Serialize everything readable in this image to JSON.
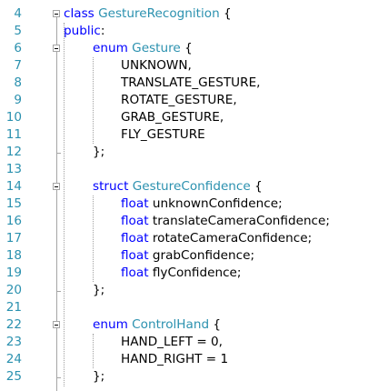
{
  "lines": [
    {
      "num": "4",
      "tokens": [
        {
          "t": "class",
          "c": "kw"
        },
        {
          "t": " ",
          "c": "pl"
        },
        {
          "t": "GestureRecognition",
          "c": "ty"
        },
        {
          "t": " {",
          "c": "pl"
        }
      ]
    },
    {
      "num": "5",
      "tokens": [
        {
          "t": "public",
          "c": "kw"
        },
        {
          "t": ":",
          "c": "pl"
        }
      ]
    },
    {
      "num": "6",
      "tokens": [
        {
          "t": "enum",
          "c": "kw"
        },
        {
          "t": " ",
          "c": "pl"
        },
        {
          "t": "Gesture",
          "c": "ty"
        },
        {
          "t": " {",
          "c": "pl"
        }
      ]
    },
    {
      "num": "7",
      "tokens": [
        {
          "t": "UNKNOWN,",
          "c": "pl"
        }
      ]
    },
    {
      "num": "8",
      "tokens": [
        {
          "t": "TRANSLATE_GESTURE,",
          "c": "pl"
        }
      ]
    },
    {
      "num": "9",
      "tokens": [
        {
          "t": "ROTATE_GESTURE,",
          "c": "pl"
        }
      ]
    },
    {
      "num": "10",
      "tokens": [
        {
          "t": "GRAB_GESTURE,",
          "c": "pl"
        }
      ]
    },
    {
      "num": "11",
      "tokens": [
        {
          "t": "FLY_GESTURE",
          "c": "pl"
        }
      ]
    },
    {
      "num": "12",
      "tokens": [
        {
          "t": "};",
          "c": "pl"
        }
      ]
    },
    {
      "num": "13",
      "tokens": []
    },
    {
      "num": "14",
      "tokens": [
        {
          "t": "struct",
          "c": "kw"
        },
        {
          "t": " ",
          "c": "pl"
        },
        {
          "t": "GestureConfidence",
          "c": "ty"
        },
        {
          "t": " {",
          "c": "pl"
        }
      ]
    },
    {
      "num": "15",
      "tokens": [
        {
          "t": "float",
          "c": "kw"
        },
        {
          "t": " unknownConfidence;",
          "c": "pl"
        }
      ]
    },
    {
      "num": "16",
      "tokens": [
        {
          "t": "float",
          "c": "kw"
        },
        {
          "t": " translateCameraConfidence;",
          "c": "pl"
        }
      ]
    },
    {
      "num": "17",
      "tokens": [
        {
          "t": "float",
          "c": "kw"
        },
        {
          "t": " rotateCameraConfidence;",
          "c": "pl"
        }
      ]
    },
    {
      "num": "18",
      "tokens": [
        {
          "t": "float",
          "c": "kw"
        },
        {
          "t": " grabConfidence;",
          "c": "pl"
        }
      ]
    },
    {
      "num": "19",
      "tokens": [
        {
          "t": "float",
          "c": "kw"
        },
        {
          "t": " flyConfidence;",
          "c": "pl"
        }
      ]
    },
    {
      "num": "20",
      "tokens": [
        {
          "t": "};",
          "c": "pl"
        }
      ]
    },
    {
      "num": "21",
      "tokens": []
    },
    {
      "num": "22",
      "tokens": [
        {
          "t": "enum",
          "c": "kw"
        },
        {
          "t": " ",
          "c": "pl"
        },
        {
          "t": "ControlHand",
          "c": "ty"
        },
        {
          "t": " {",
          "c": "pl"
        }
      ]
    },
    {
      "num": "23",
      "tokens": [
        {
          "t": "HAND_LEFT = 0,",
          "c": "pl"
        }
      ]
    },
    {
      "num": "24",
      "tokens": [
        {
          "t": "HAND_RIGHT = 1",
          "c": "pl"
        }
      ]
    },
    {
      "num": "25",
      "tokens": [
        {
          "t": "};",
          "c": "pl"
        }
      ]
    }
  ],
  "colors": {
    "keyword": "#0000ff",
    "type": "#2b91af",
    "line_number": "#2b91af",
    "text": "#000000",
    "background": "#ffffff"
  }
}
